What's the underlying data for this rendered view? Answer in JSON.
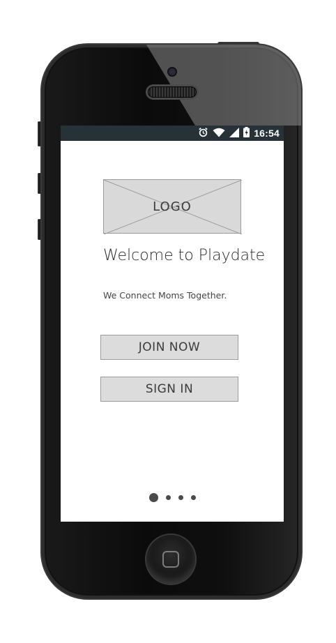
{
  "status_bar": {
    "time": "16:54",
    "icons": [
      "alarm-icon",
      "wifi-icon",
      "cell-signal-icon",
      "battery-charging-icon"
    ],
    "background": "#263238"
  },
  "logo": {
    "label": "LOGO"
  },
  "welcome": {
    "title": "Welcome to Playdate",
    "tagline": "We Connect Moms Together."
  },
  "actions": {
    "join_label": "JOIN NOW",
    "signin_label": "SIGN IN"
  },
  "pager": {
    "total": 4,
    "current": 1
  },
  "colors": {
    "button_fill": "#dcdcdc",
    "button_border": "#9a9a9a",
    "text": "#3b3b3b",
    "phone_body": "#0b0b0b"
  }
}
